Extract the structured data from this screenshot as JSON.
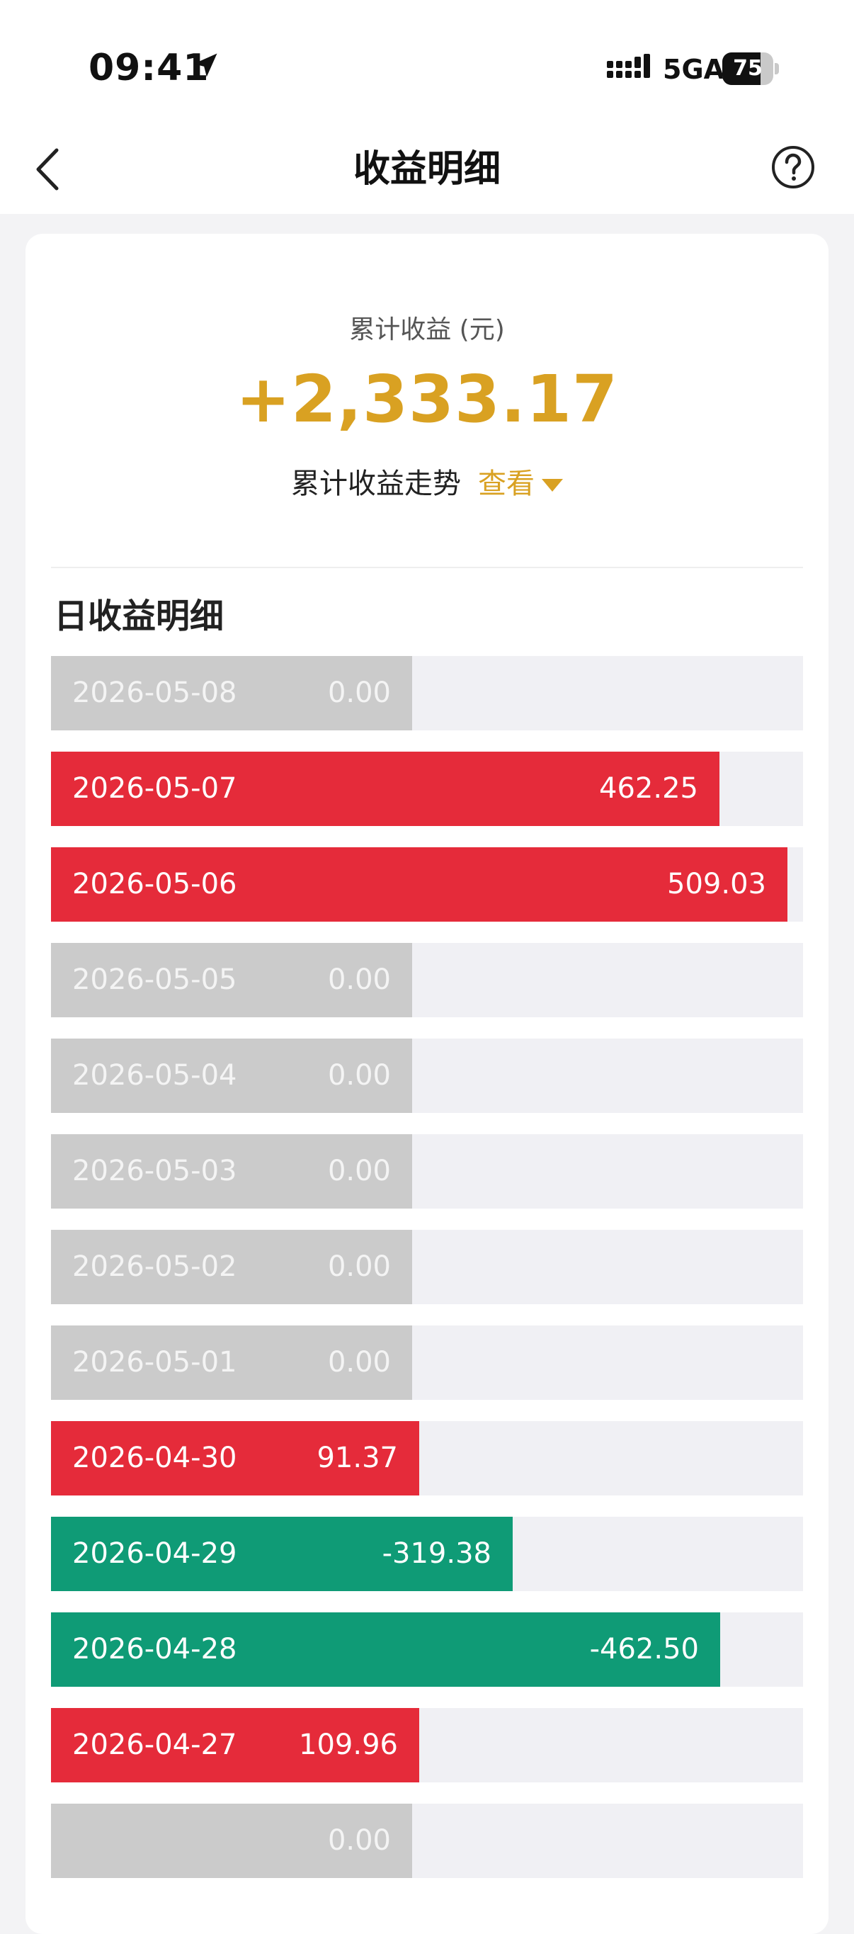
{
  "status_bar": {
    "time": "09:41",
    "network": "5GA",
    "battery": "75",
    "battery_level_pct": 75
  },
  "header": {
    "title": "收益明细"
  },
  "summary": {
    "label": "累计收益 (元)",
    "value": "+2,333.17",
    "trend_label": "累计收益走势",
    "trend_link": "查看"
  },
  "colors": {
    "gain": "#e52b3a",
    "loss": "#0f9b76",
    "zero": "#cbcbcb",
    "accent": "#d9a122"
  },
  "daily": {
    "title": "日收益明细",
    "rows": [
      {
        "date": "2026-05-08",
        "value": "0.00"
      },
      {
        "date": "2026-05-07",
        "value": "462.25"
      },
      {
        "date": "2026-05-06",
        "value": "509.03"
      },
      {
        "date": "2026-05-05",
        "value": "0.00"
      },
      {
        "date": "2026-05-04",
        "value": "0.00"
      },
      {
        "date": "2026-05-03",
        "value": "0.00"
      },
      {
        "date": "2026-05-02",
        "value": "0.00"
      },
      {
        "date": "2026-05-01",
        "value": "0.00"
      },
      {
        "date": "2026-04-30",
        "value": "91.37"
      },
      {
        "date": "2026-04-29",
        "value": "-319.38"
      },
      {
        "date": "2026-04-28",
        "value": "-462.50"
      },
      {
        "date": "2026-04-27",
        "value": "109.96"
      },
      {
        "date": "",
        "value": "0.00"
      }
    ]
  }
}
